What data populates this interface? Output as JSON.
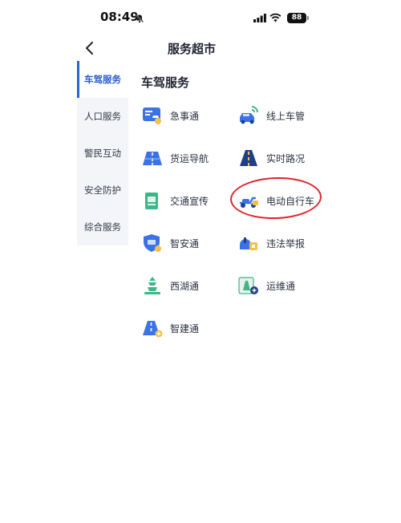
{
  "status_bar": {
    "time": "08:49",
    "battery": "88"
  },
  "nav": {
    "title": "服务超市"
  },
  "sidebar": {
    "items": [
      {
        "label": "车驾服务",
        "active": true
      },
      {
        "label": "人口服务",
        "active": false
      },
      {
        "label": "警民互动",
        "active": false
      },
      {
        "label": "安全防护",
        "active": false
      },
      {
        "label": "综合服务",
        "active": false
      }
    ]
  },
  "section": {
    "title": "车驾服务",
    "services": [
      {
        "label": "急事通",
        "icon": "car-card-icon"
      },
      {
        "label": "线上车管",
        "icon": "connected-car-icon"
      },
      {
        "label": "货运导航",
        "icon": "road-map-icon"
      },
      {
        "label": "实时路况",
        "icon": "road-icon"
      },
      {
        "label": "交通宣传",
        "icon": "booklet-icon"
      },
      {
        "label": "电动自行车",
        "icon": "e-bike-icon"
      },
      {
        "label": "智安通",
        "icon": "shield-icon"
      },
      {
        "label": "违法举报",
        "icon": "report-icon"
      },
      {
        "label": "西湖通",
        "icon": "pagoda-icon"
      },
      {
        "label": "运维通",
        "icon": "maintenance-icon"
      },
      {
        "label": "智建通",
        "icon": "construction-road-icon"
      }
    ]
  },
  "colors": {
    "accent": "#2a62e0",
    "annotation": "#e0242c",
    "icon_blue": "#3b73e6",
    "icon_yellow": "#f5c04a"
  }
}
